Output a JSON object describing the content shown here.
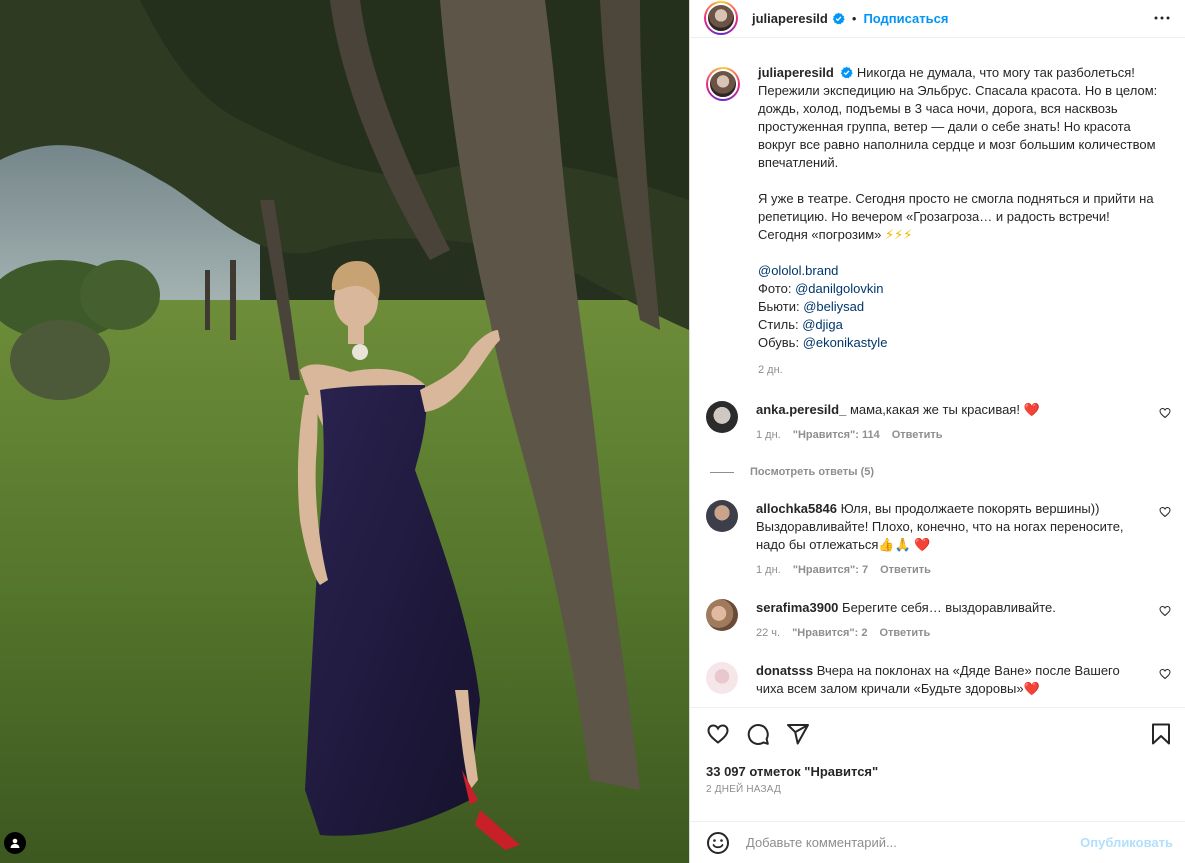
{
  "header": {
    "username": "juliaperesild",
    "dot": "•",
    "follow_label": "Подписаться"
  },
  "post": {
    "username": "juliaperesild",
    "caption_p1": "Никогда не думала, что могу так разболеться! Пережили экспедицию на Эльбрус. Спасала красота. Но в целом: дождь, холод, подъемы в 3 часа ночи, дорога, вся насквозь простуженная группа, ветер — дали о себе знать! Но красота вокруг все равно наполнила сердце и мозг большим количеством впечатлений.",
    "caption_p2": "Я уже в театре. Сегодня просто не смогла подняться и прийти на репетицию. Но вечером «Грозагроза… и радость встречи! Сегодня «погрозим» ",
    "bolts": "⚡⚡⚡",
    "credits": [
      {
        "label": "",
        "handle": "@ololol.brand"
      },
      {
        "label": "Фото: ",
        "handle": "@danilgolovkin"
      },
      {
        "label": "Бьюти: ",
        "handle": "@beliysad"
      },
      {
        "label": "Стиль: ",
        "handle": "@djiga"
      },
      {
        "label": "Обувь: ",
        "handle": "@ekonikastyle"
      }
    ],
    "time": "2 дн."
  },
  "comments": [
    {
      "user": "anka.peresild_",
      "text": "мама,какая же ты красивая! ",
      "emoji": "❤️",
      "time": "1 дн.",
      "likes": "\"Нравится\": 114",
      "reply": "Ответить"
    },
    {
      "user": "allochka5846",
      "text": "Юля, вы продолжаете покорять вершины)) Выздоравливайте! Плохо, конечно, что на ногах переносите, надо бы отлежаться👍🙏 ",
      "emoji": "❤️",
      "time": "1 дн.",
      "likes": "\"Нравится\": 7",
      "reply": "Ответить"
    },
    {
      "user": "serafima3900",
      "text": "Берегите себя… выздоравливайте.",
      "emoji": "",
      "time": "22 ч.",
      "likes": "\"Нравится\": 2",
      "reply": "Ответить"
    },
    {
      "user": "donatsss",
      "text": "Вчера на поклонах на «Дяде Ване» после Вашего чиха всем залом кричали «Будьте здоровы»",
      "emoji": "❤️",
      "time": "",
      "likes": "",
      "reply": ""
    }
  ],
  "view_replies": "Посмотреть ответы (5)",
  "footer": {
    "likes": "33 097 отметок \"Нравится\"",
    "ago": "2 ДНЕЙ НАЗАД",
    "add_placeholder": "Добавьте комментарий...",
    "publish": "Опубликовать"
  },
  "colors": {
    "accent": "#0095f6",
    "mention": "#00376b",
    "muted": "#8e8e8e",
    "heart": "#ed4956"
  }
}
